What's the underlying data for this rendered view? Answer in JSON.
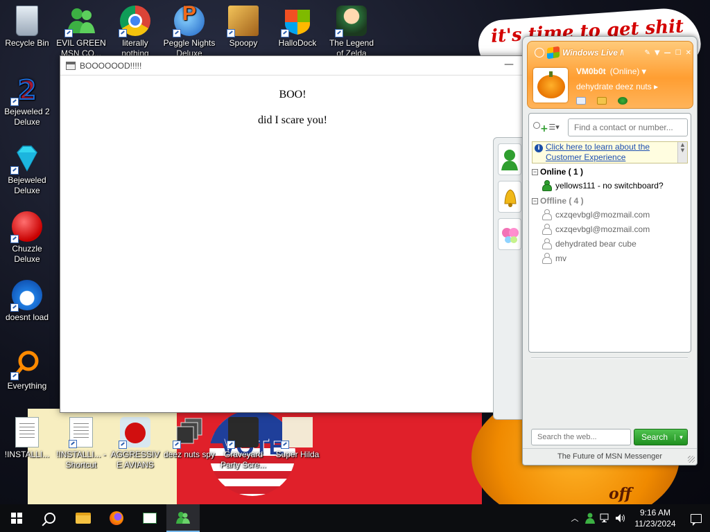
{
  "wallpaper": {
    "banner_text": "it's time to get shit",
    "pumpkin_text": "off",
    "vote_text": "VOTE"
  },
  "desktop_icons": [
    {
      "label": "Recycle Bin",
      "icon": "recycle-bin-icon"
    },
    {
      "label": "EVIL GREEN MSN CO...",
      "icon": "msn-messenger-icon"
    },
    {
      "label": "literally nothing",
      "icon": "chrome-icon"
    },
    {
      "label": "Peggle Nights Deluxe",
      "icon": "peggle-icon"
    },
    {
      "label": "Spoopy",
      "icon": "spoopy-icon"
    },
    {
      "label": "HalloDock",
      "icon": "windows-logo-icon"
    },
    {
      "label": "The Legend of Zelda",
      "icon": "legend-icon"
    },
    {
      "label": "Bejeweled 2 Deluxe",
      "icon": "bejeweled-2-icon"
    },
    {
      "label": "Bejeweled Deluxe",
      "icon": "diamond-icon"
    },
    {
      "label": "Chuzzle Deluxe",
      "icon": "chuzzle-icon"
    },
    {
      "label": "doesnt load",
      "icon": "thunderbird-icon"
    },
    {
      "label": "Everything",
      "icon": "everything-icon"
    },
    {
      "label": "!INSTALLI...",
      "icon": "document-icon"
    },
    {
      "label": "!INSTALLI... - Shortcut",
      "icon": "document-icon"
    },
    {
      "label": "AGGRESSIVE AVIANS",
      "icon": "angry-bird-icon"
    },
    {
      "label": "deez nuts spy",
      "icon": "windows-stack-icon"
    },
    {
      "label": "Graveyard Party Scre...",
      "icon": "graveyard-icon"
    },
    {
      "label": "Super Hilda",
      "icon": "hilda-icon"
    }
  ],
  "boo_window": {
    "title": "BOOOOOOD!!!!!",
    "minimize": "—",
    "heading": "BOO!",
    "message": "did I scare you!"
  },
  "msn": {
    "brand": "Windows Live Messenger",
    "display_name": "VM0b0t",
    "status": "(Online)",
    "personal_message": "dehydrate deez nuts",
    "find_placeholder": "Find a contact or number...",
    "info_link": "Click here to learn about the Customer Experience",
    "groups": [
      {
        "title": "Online ( 1 )",
        "state": "online",
        "contacts": [
          "yellows111 - no switchboard?"
        ]
      },
      {
        "title": "Offline ( 4 )",
        "state": "offline",
        "contacts": [
          "cxzqevbgl@mozmail.com",
          "cxzqevbgl@mozmail.com",
          "dehydrated bear cube",
          "mv"
        ]
      }
    ],
    "web_search_placeholder": "Search the web...",
    "search_button": "Search",
    "footer": "The Future of MSN Messenger"
  },
  "taskbar": {
    "time": "9:16 AM",
    "date": "11/23/2024"
  },
  "colors": {
    "msn_orange": "#ff9e32",
    "search_green": "#2ca02c",
    "taskbar": "#0c0d10"
  }
}
